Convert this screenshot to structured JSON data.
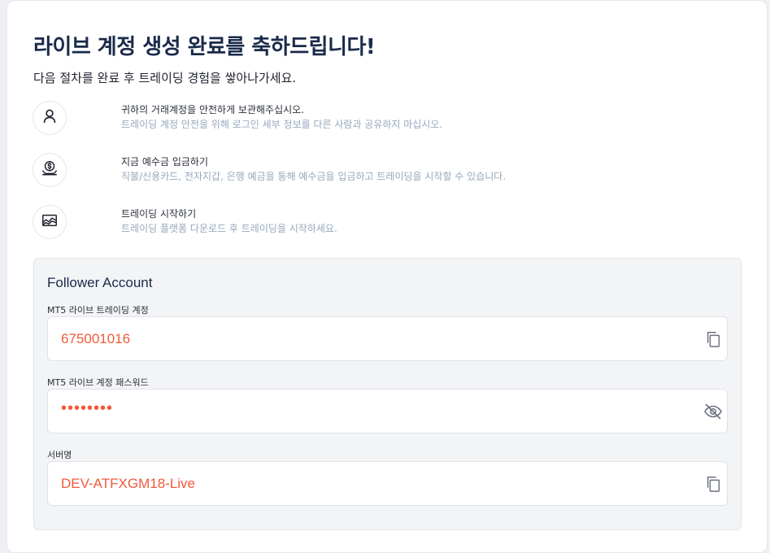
{
  "header": {
    "title": "라이브 계정 생성 완료를 축하드립니다!",
    "subtitle": "다음 절차를 완료 후 트레이딩 경험을 쌓아나가세요."
  },
  "steps": [
    {
      "icon": "user-icon",
      "title": "귀하의 거래계정을 안전하게 보관해주십시오.",
      "description": "트레이딩 계정 안전을 위해 로그인 세부 정보를 다른 사람과 공유하지 마십시오."
    },
    {
      "icon": "deposit-icon",
      "title": "지금 예수금 입금하기",
      "description": "직불/신용카드, 전자지갑, 은행 예금을 통해 예수금을 입금하고 트레이딩을 시작할 수 있습니다."
    },
    {
      "icon": "chart-icon",
      "title": "트레이딩 시작하기",
      "description": "트레이딩 플랫폼 다운로드 후 트레이딩을 시작하세요."
    }
  ],
  "account": {
    "title": "Follower Account",
    "login_label": "MT5 라이브 트레이딩 계정",
    "login_value": "675001016",
    "password_label": "MT5 라이브 계정 패스워드",
    "password_value": "••••••••",
    "server_label": "서버명",
    "server_value": "DEV-ATFXGM18-Live"
  },
  "colors": {
    "accent": "#f05a3a",
    "title": "#1a2a4a",
    "muted": "#98a8bc",
    "panel_bg": "#f3f4f6"
  }
}
